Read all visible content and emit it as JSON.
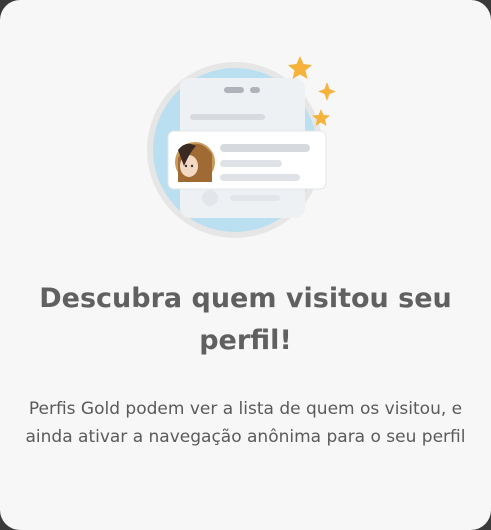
{
  "dialog": {
    "title": "Descubra quem visitou seu perfil!",
    "description": "Perfis Gold podem ver a lista de quem os visitou, e ainda ativar a navegação anônima para o seu perfil"
  },
  "illustration": {
    "icon": "profile-visitors-illustration",
    "circle_color": "#b9dff0",
    "star_color": "#f6b33c"
  }
}
